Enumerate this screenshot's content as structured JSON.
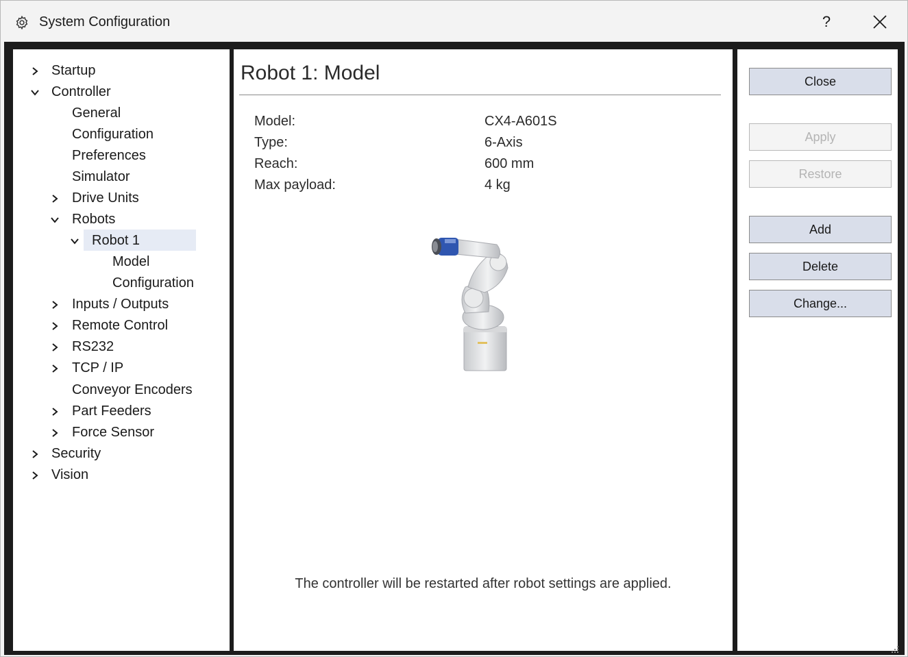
{
  "window": {
    "title": "System Configuration",
    "help_label": "?",
    "icons": {
      "title": "gear-icon",
      "close": "close-icon"
    }
  },
  "tree": {
    "items": [
      {
        "label": "Startup",
        "expander": "collapsed"
      },
      {
        "label": "Controller",
        "expander": "expanded"
      },
      {
        "label": "General",
        "expander": "none"
      },
      {
        "label": "Configuration",
        "expander": "none"
      },
      {
        "label": "Preferences",
        "expander": "none"
      },
      {
        "label": "Simulator",
        "expander": "none"
      },
      {
        "label": "Drive Units",
        "expander": "collapsed"
      },
      {
        "label": "Robots",
        "expander": "expanded"
      },
      {
        "label": "Robot 1",
        "expander": "expanded",
        "selected": true
      },
      {
        "label": "Model",
        "expander": "none"
      },
      {
        "label": "Configuration",
        "expander": "none"
      },
      {
        "label": "Inputs / Outputs",
        "expander": "collapsed"
      },
      {
        "label": "Remote Control",
        "expander": "collapsed"
      },
      {
        "label": "RS232",
        "expander": "collapsed"
      },
      {
        "label": "TCP / IP",
        "expander": "collapsed"
      },
      {
        "label": "Conveyor Encoders",
        "expander": "none"
      },
      {
        "label": "Part Feeders",
        "expander": "collapsed"
      },
      {
        "label": "Force Sensor",
        "expander": "collapsed"
      },
      {
        "label": "Security",
        "expander": "collapsed"
      },
      {
        "label": "Vision",
        "expander": "collapsed"
      }
    ],
    "selection_color": "#e6ebf5"
  },
  "main": {
    "title": "Robot 1: Model",
    "properties": [
      {
        "label": "Model:",
        "value": "CX4-A601S"
      },
      {
        "label": "Type:",
        "value": "6-Axis"
      },
      {
        "label": "Reach:",
        "value": "600 mm"
      },
      {
        "label": "Max payload:",
        "value": "4 kg"
      }
    ],
    "image_icon": "robot-arm-image",
    "notice": "The controller will be restarted after robot settings are applied."
  },
  "buttons": {
    "close": {
      "label": "Close",
      "enabled": true
    },
    "apply": {
      "label": "Apply",
      "enabled": false
    },
    "restore": {
      "label": "Restore",
      "enabled": false
    },
    "add": {
      "label": "Add",
      "enabled": true
    },
    "delete": {
      "label": "Delete",
      "enabled": true
    },
    "change": {
      "label": "Change...",
      "enabled": true
    }
  },
  "colors": {
    "frame": "#1c1c1c",
    "button_face": "#d9deea",
    "button_disabled_text": "#b4b4b4"
  }
}
